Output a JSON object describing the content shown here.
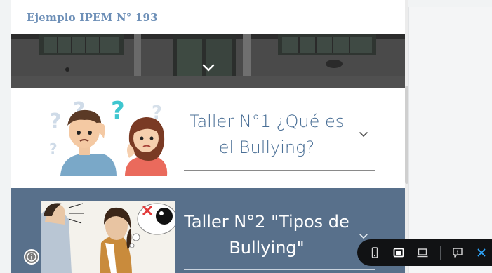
{
  "site": {
    "title": "Ejemplo IPEM N° 193"
  },
  "cards": [
    {
      "title": "Taller N°1 ¿Qué es el Bullying?"
    },
    {
      "title": "Taller N°2 \"Tipos de Bullying\""
    }
  ],
  "icons": {
    "banner_toggle": "chevron-down-icon",
    "card_toggle": "chevron-down-icon",
    "info": "info-icon",
    "mobile_view": "mobile-icon",
    "tablet_view": "tablet-icon",
    "desktop_view": "laptop-icon",
    "feedback": "feedback-icon",
    "close": "close-icon"
  },
  "colors": {
    "title_blue": "#6d8fb7",
    "card1_text": "#4a6f96",
    "card2_bg": "#58708b",
    "preview_bar": "#111214",
    "close_accent": "#2fa8ff"
  }
}
